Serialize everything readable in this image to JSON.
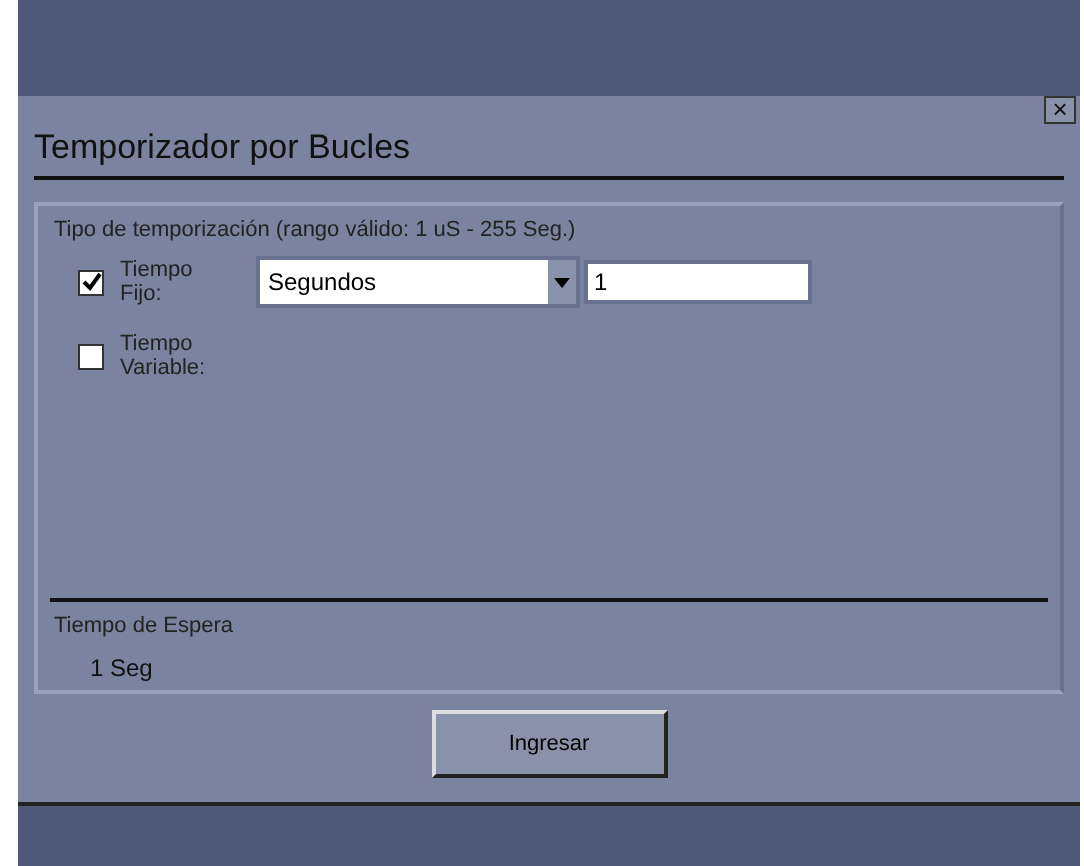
{
  "window": {
    "title": "Temporizador por Bucles",
    "close": "×"
  },
  "group": {
    "label": "Tipo de temporización (rango válido: 1 uS - 255 Seg.)",
    "options": [
      {
        "kind": "fixed",
        "label": "Tiempo Fijo:",
        "checked": true,
        "unit": "Segundos",
        "value": "1"
      },
      {
        "kind": "plain",
        "label": "Tiempo Variable:",
        "checked": false
      }
    ],
    "result_label": "Tiempo de Espera",
    "result_value": "1 Seg"
  },
  "buttons": [
    "Ingresar"
  ]
}
